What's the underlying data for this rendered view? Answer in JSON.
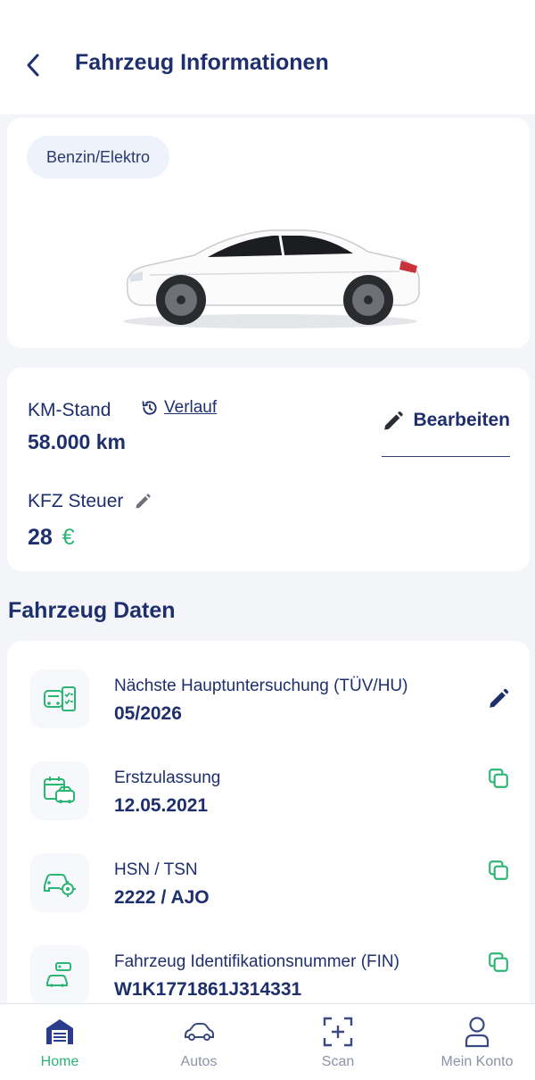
{
  "header": {
    "title": "Fahrzeug Informationen"
  },
  "vehicle": {
    "fuel_type": "Benzin/Elektro"
  },
  "mileage": {
    "label": "KM-Stand",
    "history_link": "Verlauf",
    "value": "58.000 km",
    "edit_label": "Bearbeiten"
  },
  "tax": {
    "label": "KFZ Steuer",
    "amount": "28",
    "currency": "€"
  },
  "section": {
    "title": "Fahrzeug Daten"
  },
  "rows": [
    {
      "label": "Nächste Hauptuntersuchung (TÜV/HU)",
      "value": "05/2026",
      "action": "pencil-icon"
    },
    {
      "label": "Erstzulassung",
      "value": "12.05.2021",
      "action": "copy-icon"
    },
    {
      "label": "HSN / TSN",
      "value": "2222 / AJO",
      "action": "copy-icon"
    },
    {
      "label": "Fahrzeug Identifikationsnummer (FIN)",
      "value": "W1K1771861J314331",
      "action": "copy-icon"
    }
  ],
  "nav": [
    {
      "label": "Home",
      "icon": "garage-icon",
      "active": true
    },
    {
      "label": "Autos",
      "icon": "car-icon",
      "active": false
    },
    {
      "label": "Scan",
      "icon": "scan-icon",
      "active": false
    },
    {
      "label": "Mein Konto",
      "icon": "user-icon",
      "active": false
    }
  ],
  "colors": {
    "primary": "#1e2f6e",
    "accent": "#2bb673",
    "nav_inactive": "#8c93a6"
  }
}
